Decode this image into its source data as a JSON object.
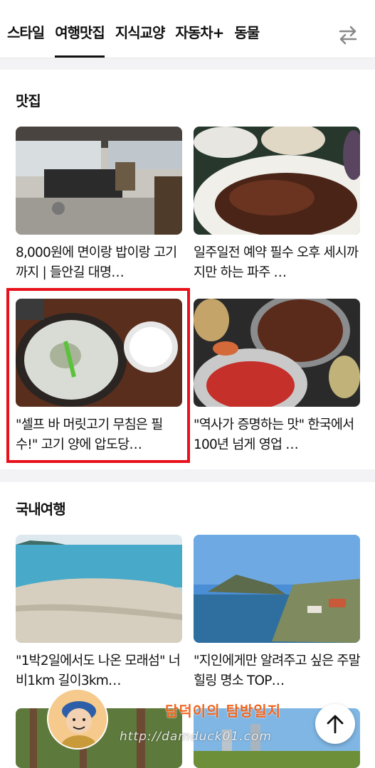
{
  "tabs": [
    "스타일",
    "여행맛집",
    "지식교양",
    "자동차+",
    "동물"
  ],
  "active_tab": "여행맛집",
  "sections": {
    "food": {
      "title": "맛집",
      "cards": [
        {
          "caption": "8,000원에 면이랑 밥이랑 고기까지 | 들안길 대명…"
        },
        {
          "caption": "일주일전 예약 필수 오후 세시까지만 하는 파주 …"
        },
        {
          "caption": "\"셀프 바 머릿고기 무침은 필수!\" 고기 양에 압도당…"
        },
        {
          "caption": "\"역사가 증명하는 맛\" 한국에서 100년 넘게 영업 …"
        }
      ]
    },
    "travel": {
      "title": "국내여행",
      "cards": [
        {
          "caption": "\"1박2일에서도 나온 모래섬\" 너비1km 길이3km…"
        },
        {
          "caption": "\"지인에게만 알려주고 싶은 주말 힐링 명소 TOP…"
        }
      ]
    }
  },
  "watermark": {
    "title": "담덕이의 탐방일지",
    "url": "http://damduck01.com"
  },
  "icons": {
    "swap": "swap-arrows-icon",
    "scroll_top": "arrow-up-icon"
  },
  "colors": {
    "highlight": "#e8101b",
    "watermark": "#f0641e"
  }
}
